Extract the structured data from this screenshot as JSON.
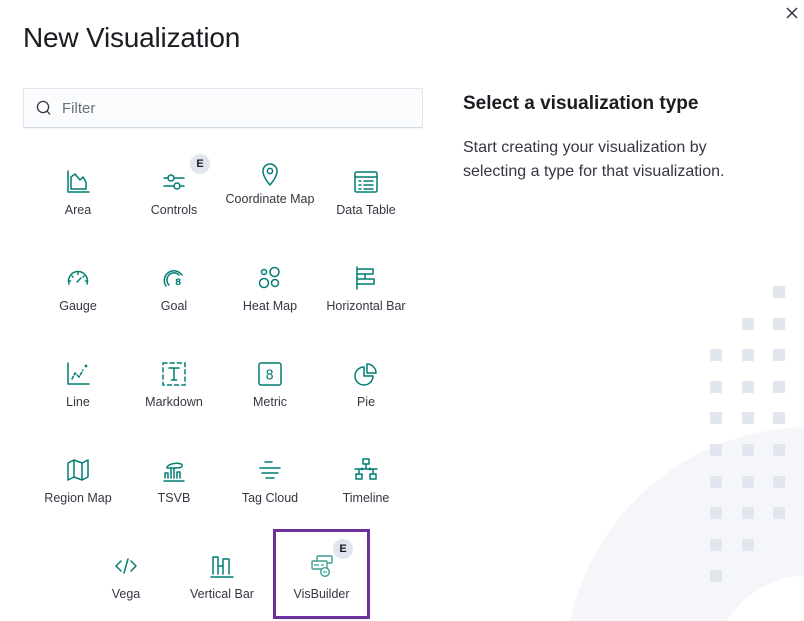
{
  "modal": {
    "title": "New Visualization",
    "close_icon": "close-icon"
  },
  "search": {
    "placeholder": "Filter",
    "value": "",
    "icon": "search-icon"
  },
  "visualization_types": [
    {
      "label": "Area",
      "icon": "area-chart-icon",
      "badge": null
    },
    {
      "label": "Controls",
      "icon": "controls-icon",
      "badge": "E"
    },
    {
      "label": "Coordinate Map",
      "icon": "map-pin-icon",
      "badge": null
    },
    {
      "label": "Data Table",
      "icon": "table-icon",
      "badge": null
    },
    {
      "label": "Gauge",
      "icon": "gauge-icon",
      "badge": null
    },
    {
      "label": "Goal",
      "icon": "goal-icon",
      "badge": null
    },
    {
      "label": "Heat Map",
      "icon": "heatmap-icon",
      "badge": null
    },
    {
      "label": "Horizontal Bar",
      "icon": "horizontal-bar-icon",
      "badge": null
    },
    {
      "label": "Line",
      "icon": "line-chart-icon",
      "badge": null
    },
    {
      "label": "Markdown",
      "icon": "markdown-icon",
      "badge": null
    },
    {
      "label": "Metric",
      "icon": "metric-icon",
      "badge": null
    },
    {
      "label": "Pie",
      "icon": "pie-chart-icon",
      "badge": null
    },
    {
      "label": "Region Map",
      "icon": "region-map-icon",
      "badge": null
    },
    {
      "label": "TSVB",
      "icon": "tsvb-icon",
      "badge": null
    },
    {
      "label": "Tag Cloud",
      "icon": "tag-cloud-icon",
      "badge": null
    },
    {
      "label": "Timeline",
      "icon": "timeline-icon",
      "badge": null
    },
    {
      "label": "Vega",
      "icon": "code-icon",
      "badge": null
    },
    {
      "label": "Vertical Bar",
      "icon": "vertical-bar-icon",
      "badge": null
    },
    {
      "label": "VisBuilder",
      "icon": "visbuilder-icon",
      "badge": "E",
      "selected": true
    }
  ],
  "side_panel": {
    "title": "Select a visualization type",
    "description": "Start creating your visualization by selecting a type for that visualization."
  },
  "colors": {
    "icon": "#017d73",
    "selection_outline": "#6d2f9c",
    "badge_bg": "#e0e5ee"
  }
}
